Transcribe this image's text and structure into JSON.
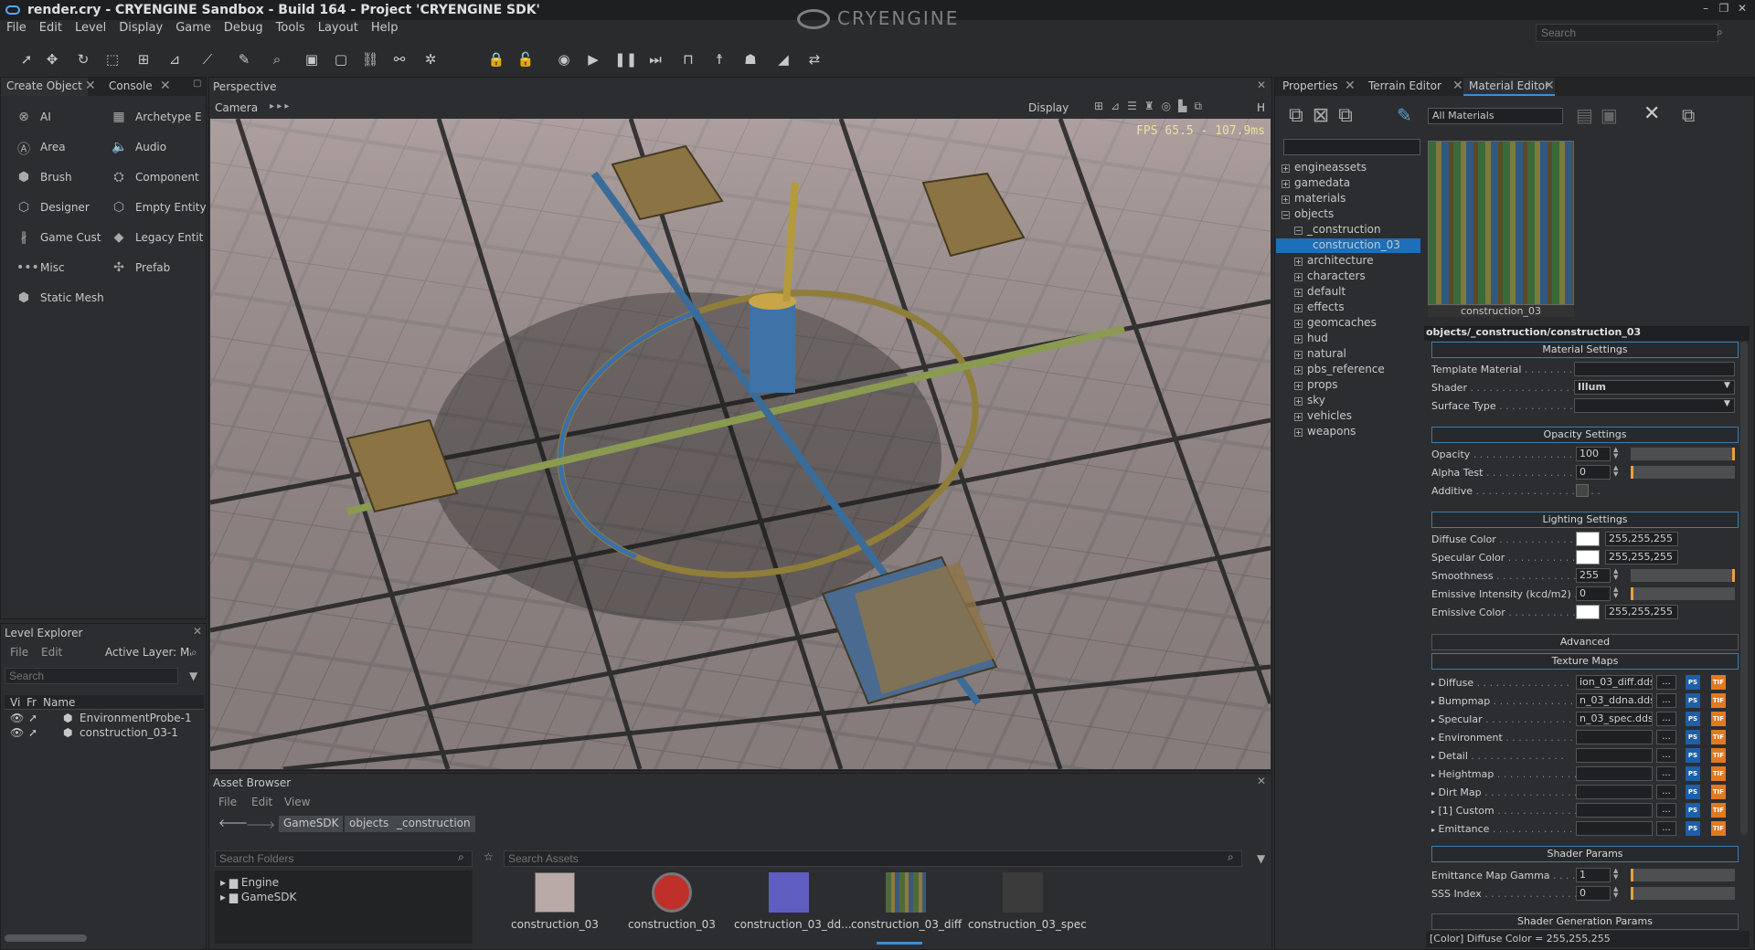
{
  "window": {
    "title": "render.cry - CRYENGINE Sandbox - Build 164 - Project 'CRYENGINE SDK'",
    "logo": "CRYENGINE",
    "search_placeholder": "Search",
    "min": "–",
    "max": "❐",
    "close": "✕"
  },
  "menu": [
    "File",
    "Edit",
    "Level",
    "Display",
    "Game",
    "Debug",
    "Tools",
    "Layout",
    "Help"
  ],
  "create_object": {
    "tabs": [
      "Create Object",
      "Console"
    ],
    "items": [
      {
        "label": "AI",
        "icon": "ai-icon"
      },
      {
        "label": "Archetype E",
        "icon": "archetype-icon"
      },
      {
        "label": "Area",
        "icon": "area-icon"
      },
      {
        "label": "Audio",
        "icon": "audio-icon"
      },
      {
        "label": "Brush",
        "icon": "brush-icon"
      },
      {
        "label": "Component",
        "icon": "component-icon"
      },
      {
        "label": "Designer",
        "icon": "designer-icon"
      },
      {
        "label": "Empty Entity",
        "icon": "empty-entity-icon"
      },
      {
        "label": "Game Cust",
        "icon": "game-cust-icon"
      },
      {
        "label": "Legacy Entit",
        "icon": "legacy-entity-icon"
      },
      {
        "label": "Misc",
        "icon": "misc-icon"
      },
      {
        "label": "Prefab",
        "icon": "prefab-icon"
      },
      {
        "label": "Static Mesh",
        "icon": "static-mesh-icon"
      }
    ]
  },
  "level_explorer": {
    "title": "Level Explorer",
    "menu": [
      "File",
      "Edit"
    ],
    "active_layer": "Active Layer: Ma",
    "search_placeholder": "Search",
    "columns": [
      "Vi",
      "Fr",
      "Name"
    ],
    "rows": [
      "EnvironmentProbe-1",
      "construction_03-1"
    ]
  },
  "perspective": {
    "title": "Perspective",
    "camera": "Camera",
    "display": "Display",
    "h": "H",
    "fps": "FPS 65.5 - 107.9ms"
  },
  "asset_browser": {
    "title": "Asset Browser",
    "menu": [
      "File",
      "Edit",
      "View"
    ],
    "breadcrumb": [
      "GameSDK",
      "objects",
      "_construction"
    ],
    "folders_placeholder": "Search Folders",
    "assets_placeholder": "Search Assets",
    "folders": [
      "Engine",
      "GameSDK"
    ],
    "assets": [
      {
        "label": "construction_03"
      },
      {
        "label": "construction_03"
      },
      {
        "label": "construction_03_dd..."
      },
      {
        "label": "construction_03_diff"
      },
      {
        "label": "construction_03_spec"
      }
    ]
  },
  "right_tabs": [
    "Properties",
    "Terrain Editor",
    "Material Editor"
  ],
  "material_editor": {
    "filter": "All Materials",
    "tree": [
      "engineassets",
      "gamedata",
      "materials",
      "objects",
      "_construction",
      "construction_03",
      "architecture",
      "characters",
      "default",
      "effects",
      "geomcaches",
      "hud",
      "natural",
      "pbs_reference",
      "props",
      "sky",
      "vehicles",
      "weapons"
    ],
    "preview_label": "construction_03",
    "path": "objects/_construction/construction_03",
    "sections": {
      "material": "Material Settings",
      "opacity": "Opacity Settings",
      "lighting": "Lighting Settings",
      "advanced": "Advanced",
      "texture": "Texture Maps",
      "shader_params": "Shader Params",
      "shader_gen": "Shader Generation Params"
    },
    "material": {
      "template": "Template Material",
      "shader_label": "Shader",
      "shader": "Illum",
      "surface": "Surface Type"
    },
    "opacity": {
      "opacity_label": "Opacity",
      "opacity": "100",
      "alpha_label": "Alpha Test",
      "alpha": "0",
      "additive_label": "Additive"
    },
    "lighting": {
      "diffuse_label": "Diffuse Color",
      "diffuse": "255,255,255",
      "specular_label": "Specular Color",
      "specular": "255,255,255",
      "smooth_label": "Smoothness",
      "smooth": "255",
      "emis_int_label": "Emissive Intensity (kcd/m2)",
      "emis_int": "0",
      "emis_col_label": "Emissive Color",
      "emis_col": "255,255,255"
    },
    "textures": [
      {
        "label": "Diffuse",
        "value": "ion_03_diff.dds"
      },
      {
        "label": "Bumpmap",
        "value": "n_03_ddna.dds"
      },
      {
        "label": "Specular",
        "value": "n_03_spec.dds"
      },
      {
        "label": "Environment",
        "value": ""
      },
      {
        "label": "Detail",
        "value": ""
      },
      {
        "label": "Heightmap",
        "value": ""
      },
      {
        "label": "Dirt Map",
        "value": ""
      },
      {
        "label": "[1] Custom",
        "value": ""
      },
      {
        "label": "Emittance",
        "value": ""
      }
    ],
    "shader_params": {
      "gamma_label": "Emittance Map Gamma",
      "gamma": "1",
      "sss_label": "SSS Index",
      "sss": "0"
    },
    "status": "[Color] Diffuse Color = 255,255,255"
  },
  "colors": {
    "accent": "#3a8fd0",
    "selection": "#1c6fb8",
    "bg": "#2c2d30"
  }
}
